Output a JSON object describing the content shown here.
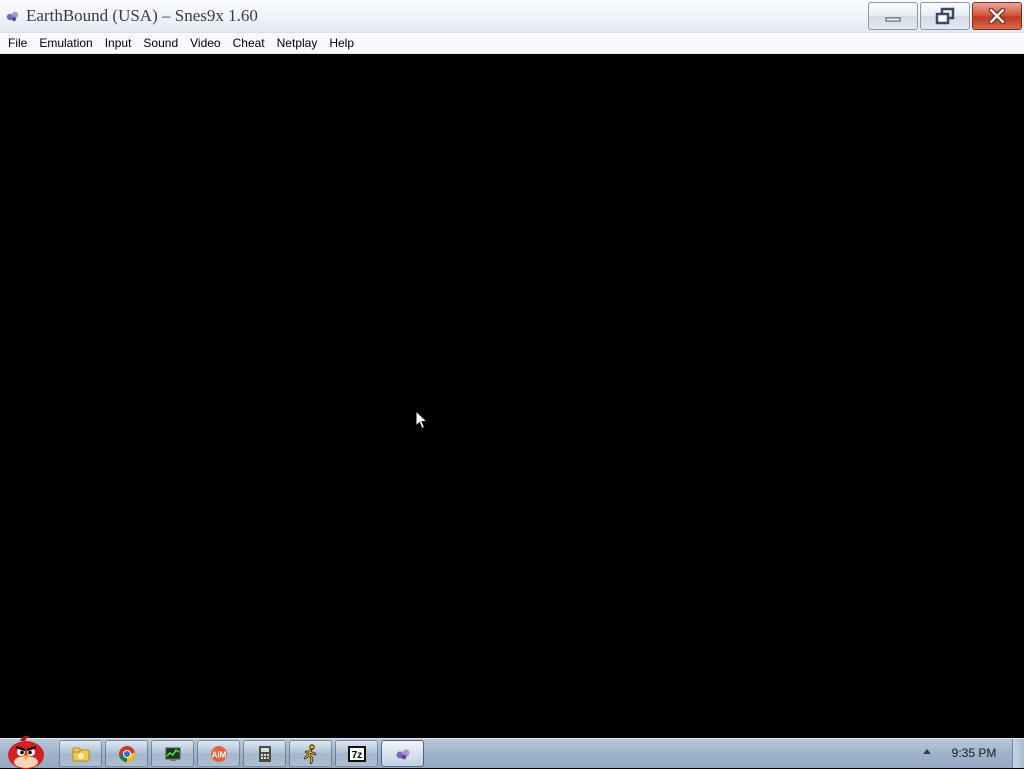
{
  "window": {
    "title": "EarthBound (USA) – Snes9x 1.60",
    "icon": "snes9x-app-icon",
    "controls": [
      "minimize-icon",
      "restore-icon",
      "close-icon"
    ]
  },
  "menu": {
    "items": [
      {
        "label": "File"
      },
      {
        "label": "Emulation"
      },
      {
        "label": "Input"
      },
      {
        "label": "Sound"
      },
      {
        "label": "Video"
      },
      {
        "label": "Cheat"
      },
      {
        "label": "Netplay"
      },
      {
        "label": "Help"
      }
    ]
  },
  "game": {
    "background": "#000000"
  },
  "taskbar": {
    "start": "angry-bird-start-orb-icon",
    "pinned": [
      {
        "name": "windows-explorer-icon"
      },
      {
        "name": "chrome-icon"
      },
      {
        "name": "task-manager-icon"
      },
      {
        "name": "aim-icon"
      },
      {
        "name": "calculator-icon"
      },
      {
        "name": "aim-runner-icon"
      },
      {
        "name": "7zip-icon",
        "text": "7z"
      },
      {
        "name": "snes9x-icon"
      }
    ],
    "clock": "9:35 PM"
  },
  "colors": {
    "close_button": "#c94a30",
    "titlebar": "#eef2f8",
    "taskbar": "#a3b7cd"
  }
}
